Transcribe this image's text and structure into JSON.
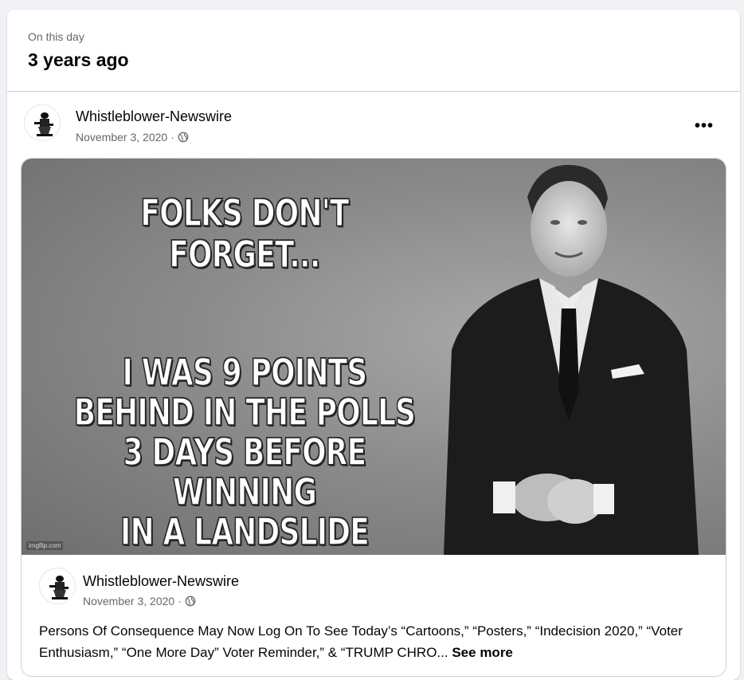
{
  "memory": {
    "kicker": "On this day",
    "title": "3 years ago"
  },
  "post": {
    "author": "Whistleblower-Newswire",
    "date": "November 3, 2020",
    "separator": "·",
    "privacy_icon": "globe-icon",
    "more_icon": "more-options-icon",
    "more_label": "•••"
  },
  "meme": {
    "headline": "FOLKS DON'T FORGET...",
    "body_lines": [
      "I WAS 9 POINTS",
      "BEHIND IN THE POLLS",
      "3 DAYS BEFORE WINNING",
      "IN A LANDSLIDE"
    ],
    "watermark": "imgflip.com"
  },
  "shared": {
    "author": "Whistleblower-Newswire",
    "date": "November 3, 2020",
    "separator": "·",
    "text": "Persons Of Consequence May Now Log On To See Today’s “Cartoons,” “Posters,” “Indecision 2020,” “Voter Enthusiasm,” “One More Day” Voter Reminder,” & “TRUMP CHRO...",
    "see_more": "See more"
  },
  "colors": {
    "background": "#f0f2f5",
    "card": "#ffffff",
    "secondary_text": "#65676b",
    "border": "#ced0d4"
  }
}
